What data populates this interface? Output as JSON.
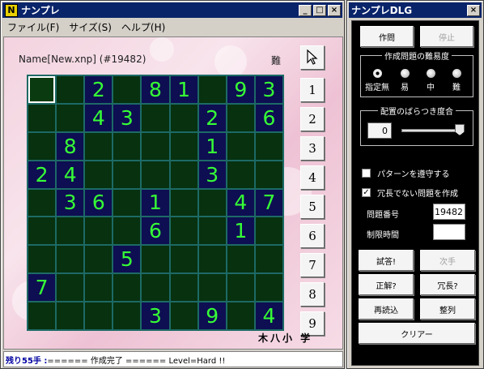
{
  "main": {
    "title": "ナンプレ",
    "menu": [
      "ファイル(F)",
      "サイズ(S)",
      "ヘルプ(H)"
    ],
    "filename": "Name[New.xnp] (#19482)",
    "difficulty_label": "難",
    "grid": [
      [
        "",
        "",
        "2",
        "",
        "8",
        "1",
        "",
        "9",
        "3"
      ],
      [
        "",
        "",
        "4",
        "3",
        "",
        "",
        "2",
        "",
        "6"
      ],
      [
        "",
        "8",
        "",
        "",
        "",
        "",
        "1",
        "",
        ""
      ],
      [
        "2",
        "4",
        "",
        "",
        "",
        "",
        "3",
        "",
        ""
      ],
      [
        "",
        "3",
        "6",
        "",
        "1",
        "",
        "",
        "4",
        "7"
      ],
      [
        "",
        "",
        "",
        "",
        "6",
        "",
        "",
        "1",
        ""
      ],
      [
        "",
        "",
        "",
        "5",
        "",
        "",
        "",
        "",
        ""
      ],
      [
        "7",
        "",
        "",
        "",
        "",
        "",
        "",
        "",
        ""
      ],
      [
        "",
        "",
        "",
        "",
        "3",
        "",
        "9",
        "",
        "4"
      ]
    ],
    "number_buttons": [
      "1",
      "2",
      "3",
      "4",
      "5",
      "6",
      "7",
      "8",
      "9"
    ],
    "signature": "木八小 学",
    "status_prefix": "残り55手 :",
    "status_text": " ====== 作成完了 ======  Level=Hard !!"
  },
  "dlg": {
    "title": "ナンプレDLG",
    "create_button": "作問",
    "stop_button": "停止",
    "difficulty_group": "作成問題の難易度",
    "difficulty_options": [
      "指定無",
      "易",
      "中",
      "難"
    ],
    "spread_group": "配置のばらつき度合",
    "spread_value": "0",
    "spread_level": 1.0,
    "pattern_check": "パターンを遵守する",
    "nonredundant_check": "冗長でない問題を作成",
    "problem_no_label": "問題番号",
    "problem_no_value": "19482",
    "time_limit_label": "制限時間",
    "time_limit_value": "",
    "answer_button": "試答!",
    "next_button": "次手",
    "correct_button": "正解?",
    "redundant_button": "冗長?",
    "reload_button": "再読込",
    "sort_button": "整列",
    "clear_button": "クリアー"
  }
}
